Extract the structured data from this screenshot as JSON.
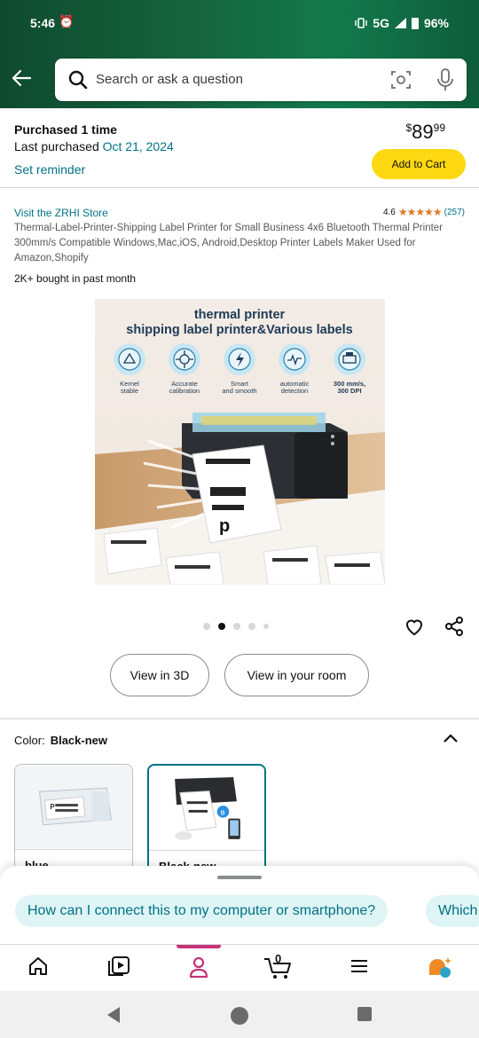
{
  "status_bar": {
    "time": "5:46",
    "network": "5G",
    "battery": "96%"
  },
  "search": {
    "placeholder": "Search or ask a question"
  },
  "purchase": {
    "title": "Purchased 1 time",
    "last_label": "Last purchased",
    "last_date": "Oct 21, 2024",
    "reminder": "Set reminder",
    "price_symbol": "$",
    "price_whole": "89",
    "price_fraction": "99",
    "add_to_cart": "Add to Cart"
  },
  "product": {
    "store": "Visit the ZRHI Store",
    "rating": "4.6",
    "stars": "★★★★★",
    "review_count": "(257)",
    "title": "Thermal-Label-Printer-Shipping Label Printer for Small Business 4x6 Bluetooth Thermal Printer 300mm/s Compatible Windows,Mac,iOS, Android,Desktop Printer Labels Maker Used for Amazon,Shopify",
    "bought": "2K+ bought in past month",
    "image": {
      "headline1": "thermal printer",
      "headline2": "shipping label printer&Various labels",
      "features": [
        {
          "line1": "Kernel",
          "line2": "stable"
        },
        {
          "line1": "Accurate",
          "line2": "calibration"
        },
        {
          "line1": "Smart",
          "line2": "and smooth"
        },
        {
          "line1": "automatic",
          "line2": "detection"
        },
        {
          "line1": "300 mm/s,",
          "line2": "300 DPI"
        }
      ]
    },
    "image_dots": {
      "count": 5,
      "active_index": 1
    }
  },
  "actions": {
    "view_3d": "View in 3D",
    "view_room": "View in your room"
  },
  "color": {
    "label": "Color:",
    "selected": "Black-new",
    "options": [
      {
        "name": "blue"
      },
      {
        "name": "Black-new"
      }
    ]
  },
  "rufus": {
    "chips": [
      "How can I connect this to my computer or smartphone?",
      "Which"
    ]
  },
  "bottom_nav": {
    "cart_count": "0",
    "active": "account"
  },
  "colors": {
    "header": "#15643f",
    "link": "#007185",
    "cart_button": "#ffd814",
    "star": "#de7921",
    "nav_active": "#c7327a"
  }
}
